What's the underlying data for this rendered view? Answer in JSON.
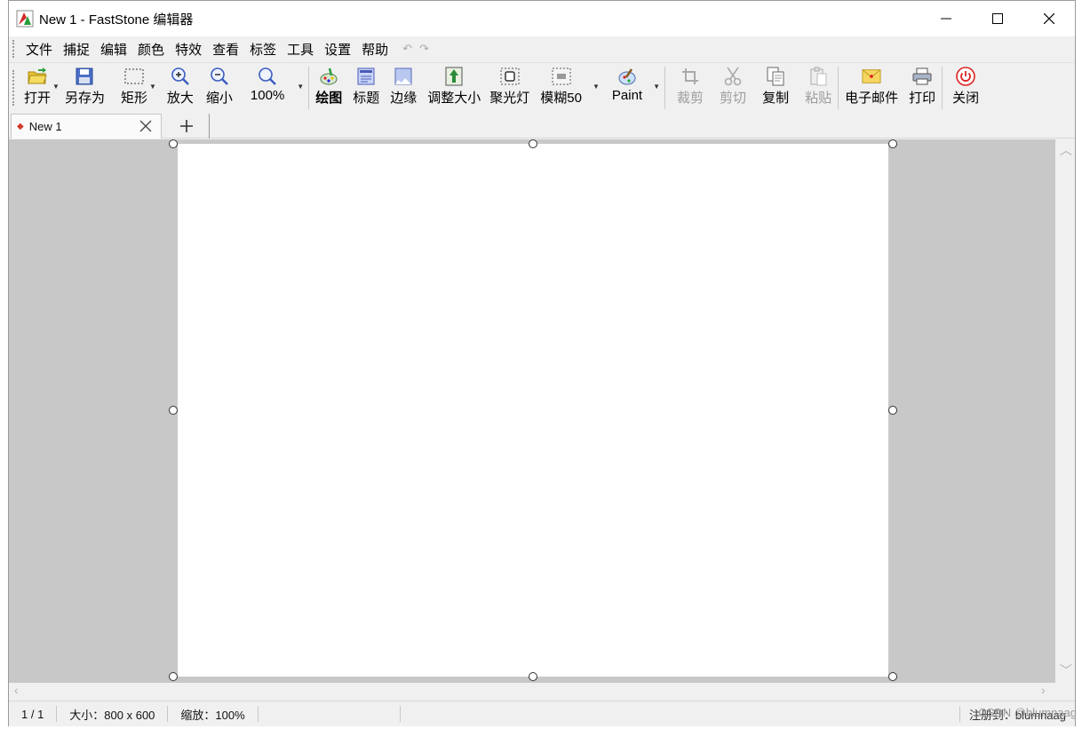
{
  "window": {
    "title": "New 1 - FastStone 编辑器"
  },
  "menu": [
    "文件",
    "捕捉",
    "编辑",
    "颜色",
    "特效",
    "查看",
    "标签",
    "工具",
    "设置",
    "帮助"
  ],
  "toolbar": {
    "open": "打开",
    "save_as": "另存为",
    "rect": "矩形",
    "zoom_in": "放大",
    "zoom_out": "缩小",
    "zoom_level": "100%",
    "draw": "绘图",
    "caption": "标题",
    "edge": "边缘",
    "resize": "调整大小",
    "spotlight": "聚光灯",
    "blur": "模糊50",
    "paint": "Paint",
    "crop": "裁剪",
    "cut": "剪切",
    "copy": "复制",
    "paste": "粘贴",
    "email": "电子邮件",
    "print": "打印",
    "close": "关闭"
  },
  "tabs": {
    "active_tab": "New 1"
  },
  "status": {
    "page": "1 / 1",
    "size": "大小：800 x 600",
    "zoom": "缩放：100%",
    "registered": "注册到：blumnaag"
  },
  "watermark": "CSDN @blumnaag",
  "colors": {
    "workspace_bg": "#c8c8c8",
    "canvas_bg": "#ffffff",
    "tab_marker": "#d23a2a"
  }
}
